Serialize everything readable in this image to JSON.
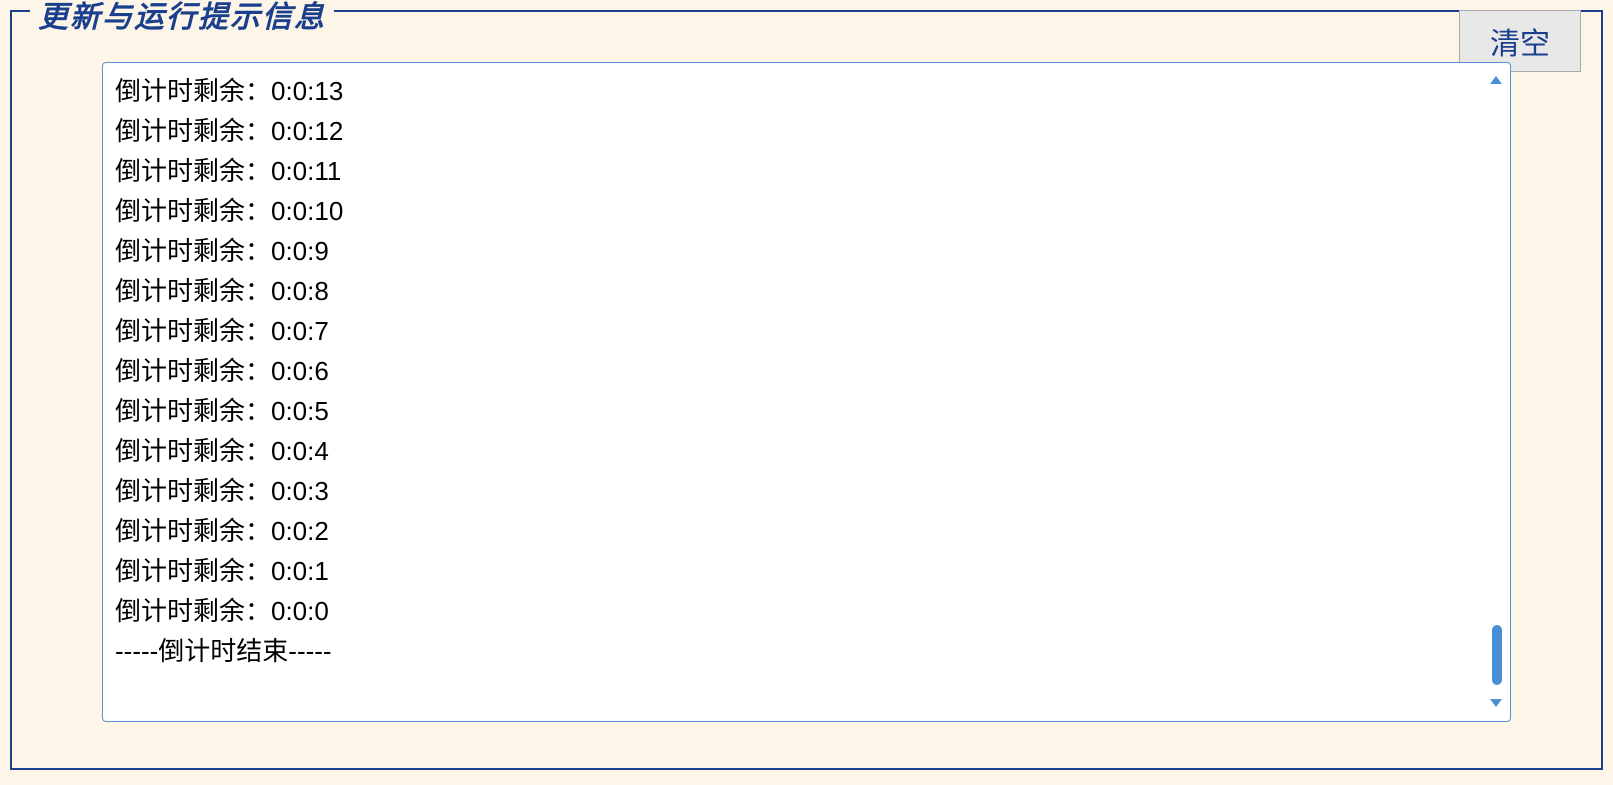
{
  "panel": {
    "legend": "更新与运行提示信息",
    "clear_button": "清空"
  },
  "log": {
    "lines": [
      "倒计时剩余：0:0:13",
      "倒计时剩余：0:0:12",
      "倒计时剩余：0:0:11",
      "倒计时剩余：0:0:10",
      "倒计时剩余：0:0:9",
      "倒计时剩余：0:0:8",
      "倒计时剩余：0:0:7",
      "倒计时剩余：0:0:6",
      "倒计时剩余：0:0:5",
      "倒计时剩余：0:0:4",
      "倒计时剩余：0:0:3",
      "倒计时剩余：0:0:2",
      "倒计时剩余：0:0:1",
      "倒计时剩余：0:0:0",
      "-----倒计时结束-----"
    ]
  }
}
